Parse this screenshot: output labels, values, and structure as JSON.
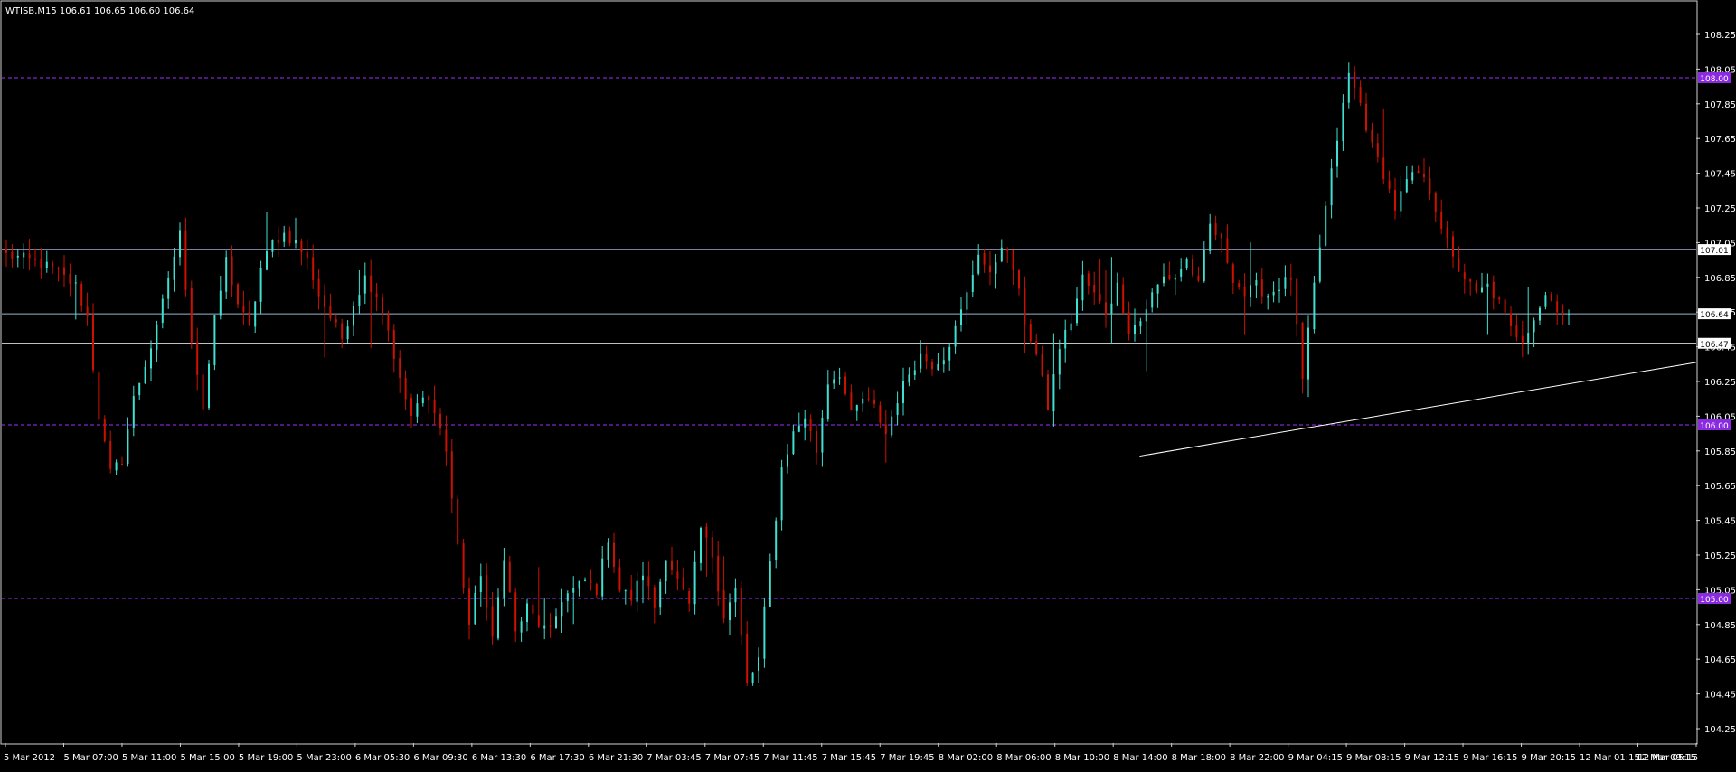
{
  "symbol_info": "WTISB,M15  106.61 106.65 106.60 106.64",
  "chart_data": {
    "type": "candlestick",
    "title": "WTISB,M15  106.61 106.65 106.60 106.64",
    "symbol": "WTISB",
    "timeframe": "M15",
    "last_ohlc": {
      "open": 106.61,
      "high": 106.65,
      "low": 106.6,
      "close": 106.64
    },
    "ylim": [
      104.15,
      108.35
    ],
    "grid": false,
    "y_ticks": [
      "108.25",
      "108.05",
      "107.85",
      "107.65",
      "107.45",
      "107.25",
      "107.05",
      "106.85",
      "106.65",
      "106.45",
      "106.25",
      "106.05",
      "105.85",
      "105.65",
      "105.45",
      "105.25",
      "105.05",
      "104.85",
      "104.65",
      "104.45",
      "104.25"
    ],
    "x_ticks": [
      "5 Mar 2012",
      "5 Mar 07:00",
      "5 Mar 11:00",
      "5 Mar 15:00",
      "5 Mar 19:00",
      "5 Mar 23:00",
      "6 Mar 05:30",
      "6 Mar 09:30",
      "6 Mar 13:30",
      "6 Mar 17:30",
      "6 Mar 21:30",
      "7 Mar 03:45",
      "7 Mar 07:45",
      "7 Mar 11:45",
      "7 Mar 15:45",
      "7 Mar 19:45",
      "8 Mar 02:00",
      "8 Mar 06:00",
      "8 Mar 10:00",
      "8 Mar 14:00",
      "8 Mar 18:00",
      "8 Mar 22:00",
      "9 Mar 04:15",
      "9 Mar 08:15",
      "9 Mar 12:15",
      "9 Mar 16:15",
      "9 Mar 20:15",
      "12 Mar 01:15",
      "12 Mar 05:15",
      "12 Mar 09:15"
    ],
    "price_anchors": [
      [
        0,
        106.98
      ],
      [
        4,
        106.95
      ],
      [
        8,
        106.9
      ],
      [
        12,
        106.8
      ],
      [
        14,
        106.62
      ],
      [
        16,
        106.05
      ],
      [
        18,
        105.72
      ],
      [
        20,
        105.8
      ],
      [
        22,
        106.15
      ],
      [
        24,
        106.35
      ],
      [
        26,
        106.55
      ],
      [
        28,
        106.85
      ],
      [
        30,
        107.1
      ],
      [
        32,
        106.5
      ],
      [
        34,
        106.1
      ],
      [
        36,
        106.6
      ],
      [
        38,
        106.95
      ],
      [
        40,
        106.7
      ],
      [
        42,
        106.55
      ],
      [
        44,
        106.9
      ],
      [
        46,
        107.05
      ],
      [
        48,
        107.1
      ],
      [
        50,
        107.05
      ],
      [
        52,
        106.95
      ],
      [
        54,
        106.75
      ],
      [
        56,
        106.62
      ],
      [
        58,
        106.5
      ],
      [
        60,
        106.7
      ],
      [
        62,
        106.85
      ],
      [
        64,
        106.75
      ],
      [
        66,
        106.55
      ],
      [
        68,
        106.25
      ],
      [
        70,
        106.05
      ],
      [
        72,
        106.15
      ],
      [
        74,
        106.1
      ],
      [
        76,
        105.85
      ],
      [
        78,
        105.3
      ],
      [
        80,
        104.85
      ],
      [
        82,
        105.15
      ],
      [
        84,
        104.75
      ],
      [
        86,
        105.25
      ],
      [
        88,
        104.8
      ],
      [
        90,
        104.95
      ],
      [
        92,
        104.85
      ],
      [
        94,
        104.8
      ],
      [
        96,
        105.0
      ],
      [
        98,
        105.05
      ],
      [
        100,
        105.1
      ],
      [
        102,
        105.05
      ],
      [
        104,
        105.35
      ],
      [
        106,
        105.05
      ],
      [
        108,
        105.0
      ],
      [
        110,
        105.15
      ],
      [
        112,
        104.95
      ],
      [
        114,
        105.25
      ],
      [
        116,
        105.1
      ],
      [
        118,
        104.95
      ],
      [
        120,
        105.4
      ],
      [
        122,
        105.25
      ],
      [
        124,
        104.9
      ],
      [
        126,
        105.05
      ],
      [
        128,
        104.5
      ],
      [
        130,
        104.65
      ],
      [
        132,
        105.2
      ],
      [
        134,
        105.75
      ],
      [
        136,
        105.95
      ],
      [
        138,
        106.05
      ],
      [
        140,
        105.85
      ],
      [
        142,
        106.25
      ],
      [
        144,
        106.3
      ],
      [
        146,
        106.05
      ],
      [
        148,
        106.15
      ],
      [
        150,
        106.1
      ],
      [
        152,
        105.95
      ],
      [
        154,
        106.15
      ],
      [
        156,
        106.3
      ],
      [
        158,
        106.4
      ],
      [
        160,
        106.35
      ],
      [
        162,
        106.4
      ],
      [
        164,
        106.55
      ],
      [
        166,
        106.75
      ],
      [
        168,
        107.0
      ],
      [
        170,
        106.85
      ],
      [
        172,
        107.05
      ],
      [
        174,
        106.9
      ],
      [
        176,
        106.6
      ],
      [
        178,
        106.4
      ],
      [
        180,
        106.1
      ],
      [
        182,
        106.45
      ],
      [
        184,
        106.6
      ],
      [
        186,
        106.85
      ],
      [
        188,
        106.75
      ],
      [
        190,
        106.65
      ],
      [
        192,
        106.8
      ],
      [
        194,
        106.55
      ],
      [
        196,
        106.6
      ],
      [
        198,
        106.75
      ],
      [
        200,
        106.85
      ],
      [
        202,
        106.85
      ],
      [
        204,
        106.95
      ],
      [
        206,
        106.8
      ],
      [
        208,
        107.15
      ],
      [
        210,
        107.05
      ],
      [
        212,
        106.85
      ],
      [
        214,
        106.75
      ],
      [
        216,
        106.8
      ],
      [
        218,
        106.75
      ],
      [
        220,
        106.8
      ],
      [
        222,
        106.85
      ],
      [
        224,
        106.25
      ],
      [
        226,
        106.8
      ],
      [
        228,
        107.25
      ],
      [
        230,
        107.65
      ],
      [
        232,
        108.02
      ],
      [
        234,
        107.85
      ],
      [
        236,
        107.6
      ],
      [
        238,
        107.45
      ],
      [
        240,
        107.25
      ],
      [
        242,
        107.4
      ],
      [
        244,
        107.45
      ],
      [
        246,
        107.35
      ],
      [
        248,
        107.15
      ],
      [
        250,
        106.95
      ],
      [
        252,
        106.85
      ],
      [
        254,
        106.75
      ],
      [
        256,
        106.8
      ],
      [
        258,
        106.7
      ],
      [
        260,
        106.55
      ],
      [
        262,
        106.5
      ],
      [
        264,
        106.62
      ],
      [
        266,
        106.75
      ],
      [
        268,
        106.68
      ],
      [
        270,
        106.64
      ]
    ],
    "horizontal_lines": [
      {
        "price": 108.0,
        "label": "108.00",
        "style": "dashed",
        "color": "#9b30ff"
      },
      {
        "price": 107.01,
        "label": "107.01",
        "style": "solid",
        "color": "#c8c8ff"
      },
      {
        "price": 106.64,
        "label": "106.64",
        "style": "solid",
        "color": "#9ab4c8"
      },
      {
        "price": 106.47,
        "label": "106.47",
        "style": "solid",
        "color": "#ffffff"
      },
      {
        "price": 106.0,
        "label": "106.00",
        "style": "dashed",
        "color": "#9b30ff"
      },
      {
        "price": 105.0,
        "label": "105.00",
        "style": "dashed",
        "color": "#9b30ff"
      }
    ],
    "trendline": {
      "from": {
        "bar": 196,
        "price": 105.82
      },
      "to": {
        "bar": 290,
        "price": 106.36
      }
    },
    "colors": {
      "up": "#40e0d0",
      "down": "#cc1100",
      "background": "#000000",
      "axis": "#d0d0d0",
      "text": "#ffffff"
    }
  }
}
